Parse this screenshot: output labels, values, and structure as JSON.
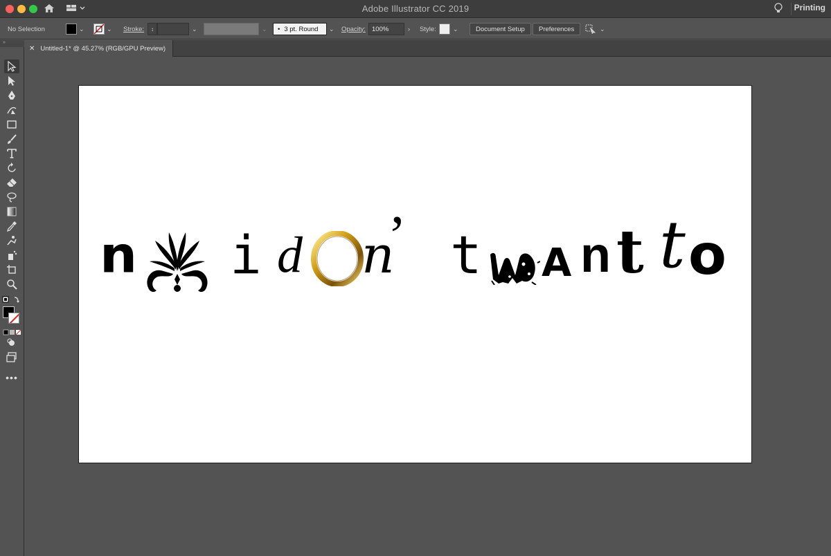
{
  "titlebar": {
    "app_title": "Adobe Illustrator CC 2019",
    "workspace": "Printing"
  },
  "controlbar": {
    "selection_label": "No Selection",
    "fill_color": "#000000",
    "stroke_label": "Stroke:",
    "brush_value": "3 pt. Round",
    "opacity_label": "Opacity:",
    "opacity_value": "100%",
    "style_label": "Style:",
    "document_setup_label": "Document Setup",
    "preferences_label": "Preferences"
  },
  "document_tab": {
    "title": "Untitled-1* @ 45.27% (RGB/GPU Preview)"
  },
  "artboard": {
    "glyphs": {
      "n1": "n",
      "i1": "i",
      "d1": "d",
      "o1": "O",
      "n2": "n",
      "apos": "’",
      "t1": "t",
      "a1": "A",
      "n3": "n",
      "t2": "t",
      "t3": "t",
      "o2": "o"
    },
    "accent_gold": "#d4a017"
  },
  "icons": [
    "home-icon",
    "workspace-layout-icon",
    "lightbulb-icon",
    "selection-tool-icon",
    "direct-selection-tool-icon",
    "pen-tool-icon",
    "curvature-tool-icon",
    "rectangle-tool-icon",
    "paintbrush-tool-icon",
    "type-tool-icon",
    "rotate-tool-icon",
    "eraser-tool-icon",
    "lasso-tool-icon",
    "gradient-tool-icon",
    "eyedropper-tool-icon",
    "puppet-warp-tool-icon",
    "symbol-sprayer-tool-icon",
    "artboard-tool-icon",
    "zoom-tool-icon",
    "swap-fill-stroke-icon",
    "fill-swatch-icon",
    "stroke-swatch-icon",
    "draw-mode-icon",
    "screen-mode-icon",
    "more-tools-icon"
  ]
}
